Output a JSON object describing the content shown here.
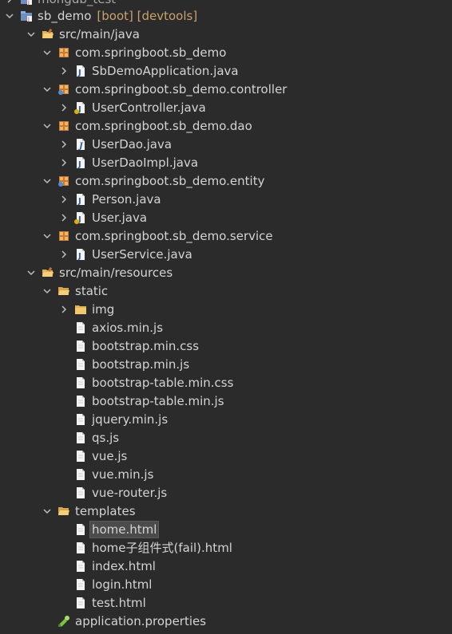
{
  "tree": {
    "items": [
      {
        "label": "mongdb_test",
        "decoration": ""
      },
      {
        "label": "sb_demo",
        "decoration": "[boot] [devtools]"
      },
      {
        "label": "src/main/java",
        "decoration": ""
      },
      {
        "label": "com.springboot.sb_demo",
        "decoration": ""
      },
      {
        "label": "SbDemoApplication.java",
        "decoration": ""
      },
      {
        "label": "com.springboot.sb_demo.controller",
        "decoration": ""
      },
      {
        "label": "UserController.java",
        "decoration": ""
      },
      {
        "label": "com.springboot.sb_demo.dao",
        "decoration": ""
      },
      {
        "label": "UserDao.java",
        "decoration": ""
      },
      {
        "label": "UserDaoImpl.java",
        "decoration": ""
      },
      {
        "label": "com.springboot.sb_demo.entity",
        "decoration": ""
      },
      {
        "label": "Person.java",
        "decoration": ""
      },
      {
        "label": "User.java",
        "decoration": ""
      },
      {
        "label": "com.springboot.sb_demo.service",
        "decoration": ""
      },
      {
        "label": "UserService.java",
        "decoration": ""
      },
      {
        "label": "src/main/resources",
        "decoration": ""
      },
      {
        "label": "static",
        "decoration": ""
      },
      {
        "label": "img",
        "decoration": ""
      },
      {
        "label": "axios.min.js",
        "decoration": ""
      },
      {
        "label": "bootstrap.min.css",
        "decoration": ""
      },
      {
        "label": "bootstrap.min.js",
        "decoration": ""
      },
      {
        "label": "bootstrap-table.min.css",
        "decoration": ""
      },
      {
        "label": "bootstrap-table.min.js",
        "decoration": ""
      },
      {
        "label": "jquery.min.js",
        "decoration": ""
      },
      {
        "label": "qs.js",
        "decoration": ""
      },
      {
        "label": "vue.js",
        "decoration": ""
      },
      {
        "label": "vue.min.js",
        "decoration": ""
      },
      {
        "label": "vue-router.js",
        "decoration": ""
      },
      {
        "label": "templates",
        "decoration": ""
      },
      {
        "label": "home.html",
        "decoration": ""
      },
      {
        "label": "home子组件式(fail).html",
        "decoration": ""
      },
      {
        "label": "index.html",
        "decoration": ""
      },
      {
        "label": "login.html",
        "decoration": ""
      },
      {
        "label": "test.html",
        "decoration": ""
      },
      {
        "label": "application.properties",
        "decoration": ""
      }
    ],
    "icons": [
      "project-icon",
      "project-icon",
      "source-folder-icon",
      "package-icon",
      "java-file-icon",
      "package-icon",
      "java-file-icon",
      "package-icon",
      "java-interface-icon",
      "java-file-icon",
      "package-icon",
      "java-file-icon",
      "java-file-icon",
      "package-icon",
      "java-file-icon",
      "source-folder-icon",
      "folder-icon",
      "folder-icon",
      "file-icon",
      "file-icon",
      "file-icon",
      "file-icon",
      "file-icon",
      "file-icon",
      "file-icon",
      "file-icon",
      "file-icon",
      "file-icon",
      "folder-icon",
      "file-icon",
      "file-icon",
      "file-icon",
      "file-icon",
      "file-icon",
      "properties-file-icon"
    ],
    "colors": {
      "background": "#2b2b2b",
      "text": "#d4d4d4",
      "decoration": "#c9a26b",
      "selection": "#4b4b4b"
    }
  }
}
